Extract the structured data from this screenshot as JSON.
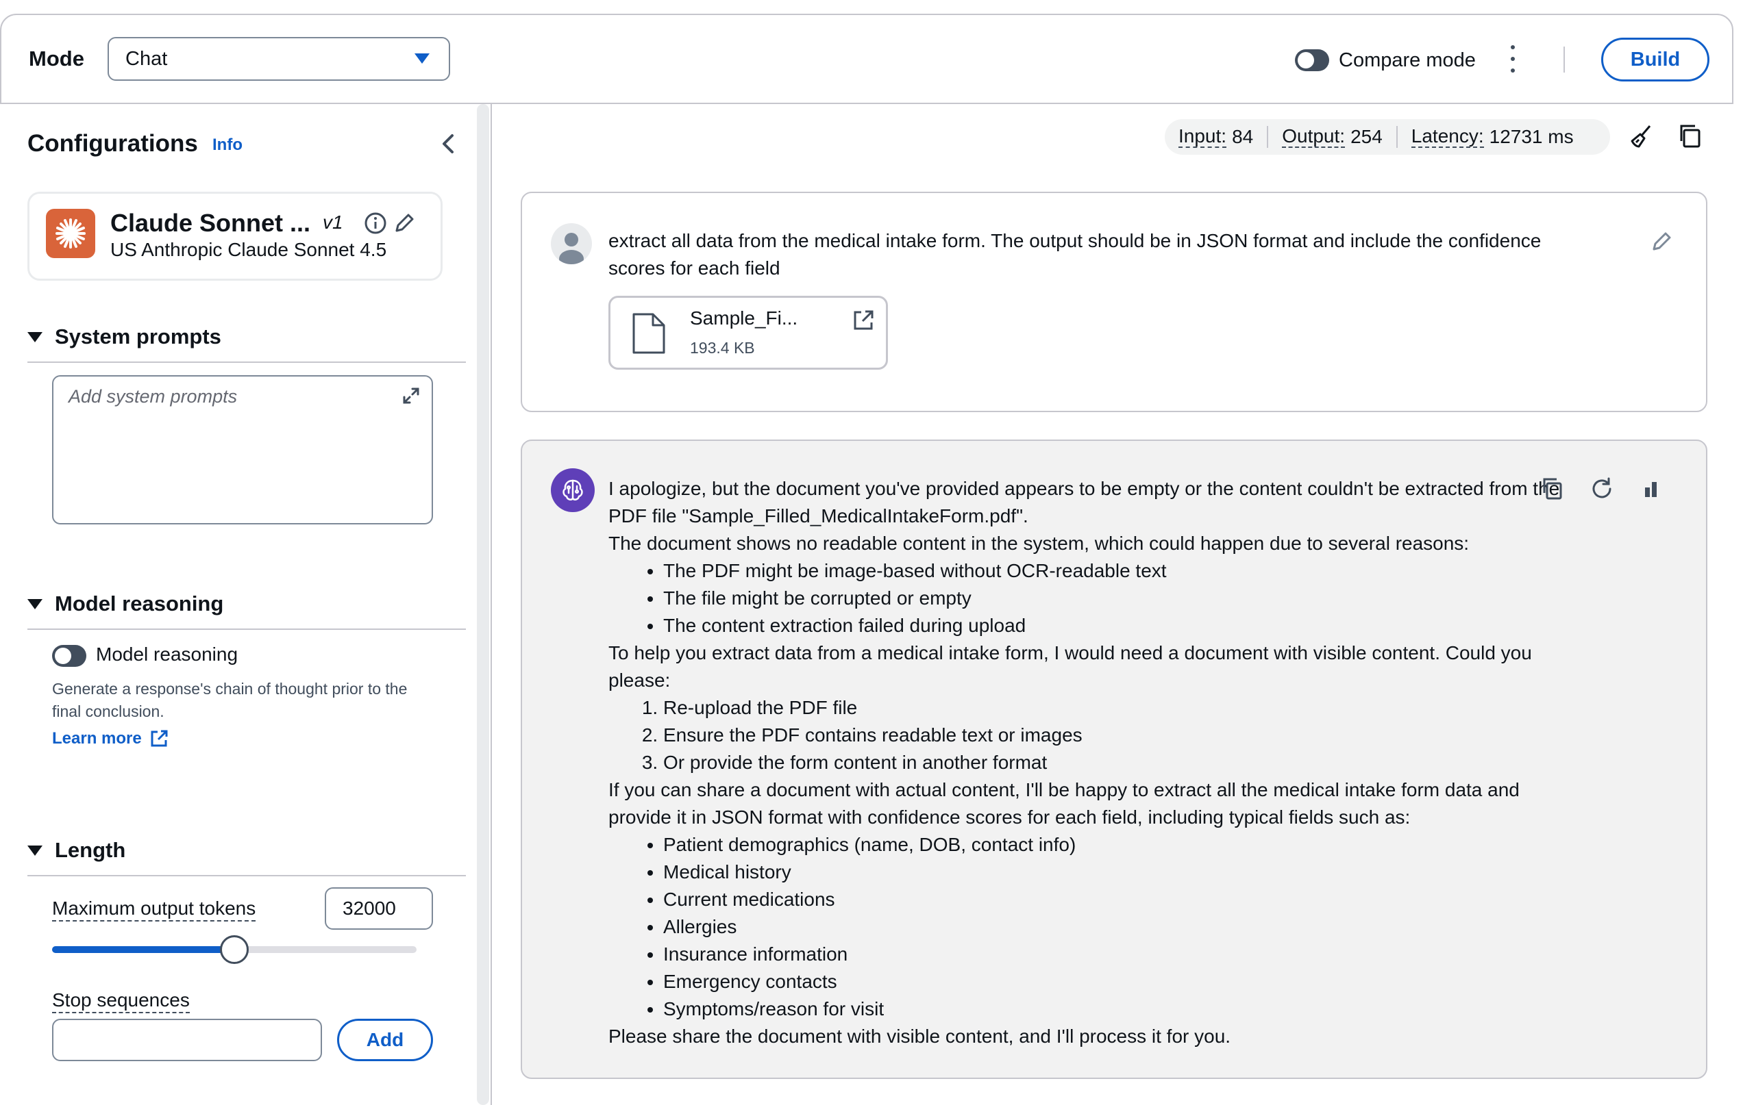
{
  "topbar": {
    "mode_label": "Mode",
    "mode_value": "Chat",
    "compare_label": "Compare mode",
    "compare_on": false,
    "build_label": "Build"
  },
  "config": {
    "title": "Configurations",
    "info": "Info",
    "model": {
      "name": "Claude Sonnet ...",
      "version": "v1",
      "provider": "US Anthropic Claude Sonnet 4.5"
    },
    "system_prompts": {
      "heading": "System prompts",
      "placeholder": "Add system prompts"
    },
    "reasoning": {
      "heading": "Model reasoning",
      "toggle_label": "Model reasoning",
      "enabled": false,
      "description": "Generate a response's chain of thought prior to the final conclusion.",
      "learn_more": "Learn more"
    },
    "length": {
      "heading": "Length",
      "max_tokens_label": "Maximum output tokens",
      "max_tokens_value": "32000",
      "slider_fraction": 0.5,
      "stop_label": "Stop sequences",
      "add_label": "Add"
    }
  },
  "metrics": {
    "input_label": "Input:",
    "input_value": "84",
    "output_label": "Output:",
    "output_value": "254",
    "latency_label": "Latency:",
    "latency_value": "12731 ms"
  },
  "user_message": {
    "text": "extract all data from the medical intake form. The output should be in JSON format and include the confidence scores for each field",
    "file_name": "Sample_Fi...",
    "file_size": "193.4 KB"
  },
  "assistant_message": {
    "p1": "I apologize, but the document you've provided appears to be empty or the content couldn't be extracted from the PDF file \"Sample_Filled_MedicalIntakeForm.pdf\".",
    "p2": "The document shows no readable content in the system, which could happen due to several reasons:",
    "reasons": [
      "The PDF might be image-based without OCR-readable text",
      "The file might be corrupted or empty",
      "The content extraction failed during upload"
    ],
    "p3": "To help you extract data from a medical intake form, I would need a document with visible content. Could you please:",
    "steps": [
      "Re-upload the PDF file",
      "Ensure the PDF contains readable text or images",
      "Or provide the form content in another format"
    ],
    "p4": "If you can share a document with actual content, I'll be happy to extract all the medical intake form data and provide it in JSON format with confidence scores for each field, including typical fields such as:",
    "fields": [
      "Patient demographics (name, DOB, contact info)",
      "Medical history",
      "Current medications",
      "Allergies",
      "Insurance information",
      "Emergency contacts",
      "Symptoms/reason for visit"
    ],
    "p5": "Please share the document with visible content, and I'll process it for you."
  },
  "colors": {
    "accent": "#0f5ec8",
    "text": "#0f141a",
    "border": "#c6c6cd",
    "model_logo": "#d9643a",
    "assistant_avatar": "#5f3fb8"
  }
}
